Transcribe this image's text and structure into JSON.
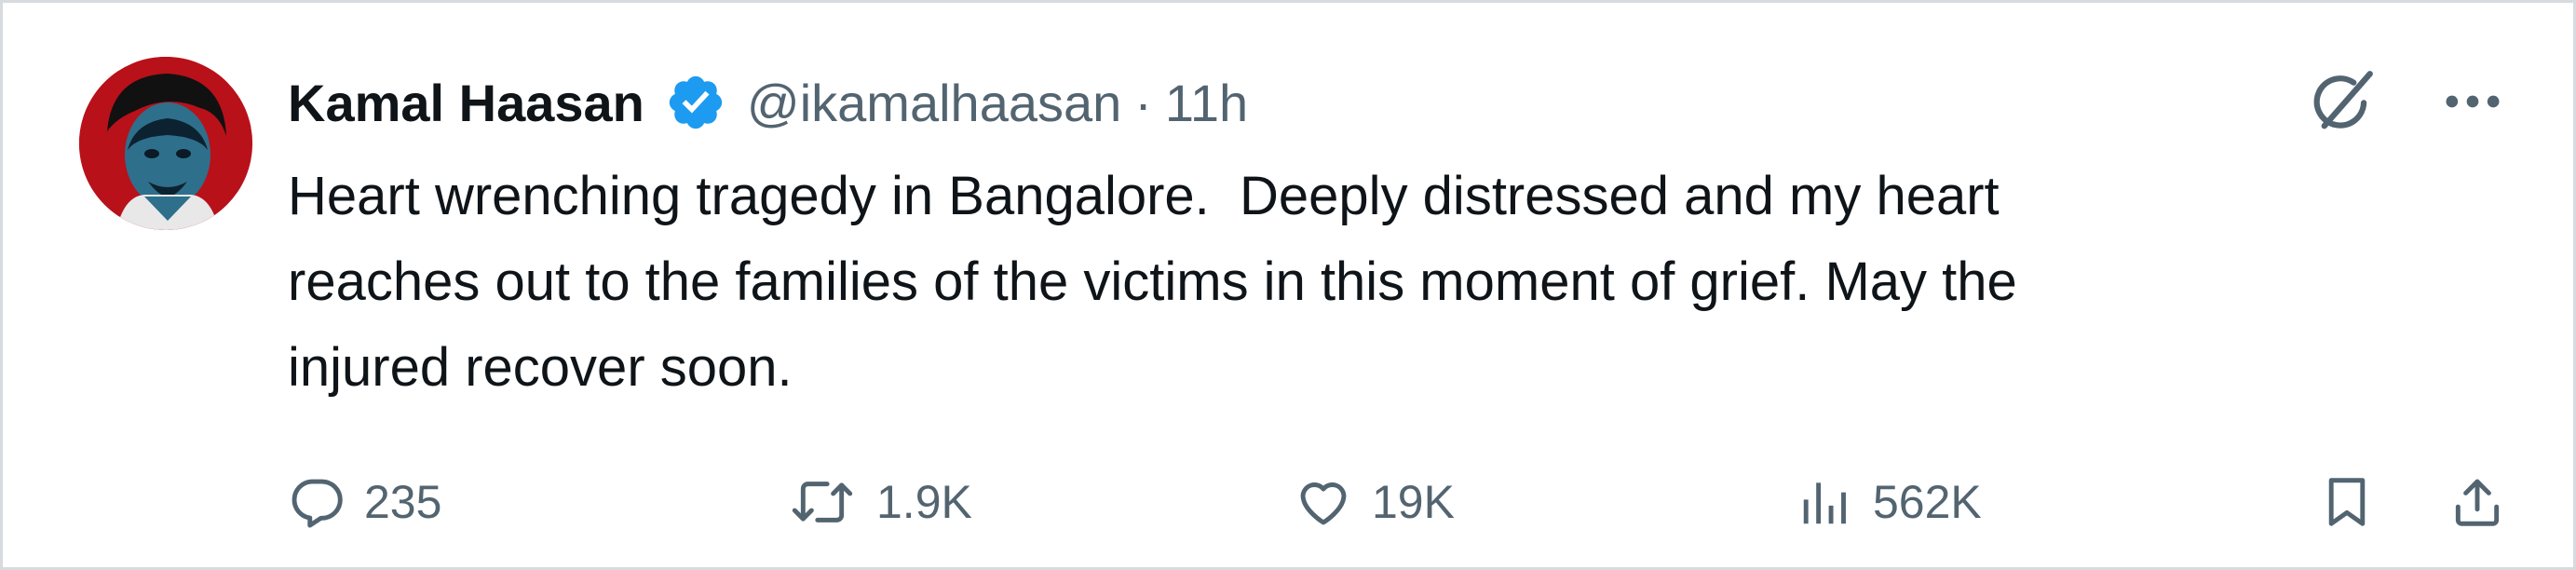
{
  "tweet": {
    "author": {
      "display_name": "Kamal Haasan",
      "verified": true,
      "verified_color": "#1d9bf0",
      "handle": "@ikamalhaasan",
      "separator": "·",
      "time": "11h"
    },
    "text_lines": [
      "Heart wrenching tragedy in Bangalore.  Deeply distressed and my heart",
      "reaches out to the families of the victims in this moment of grief. May the",
      "injured recover soon."
    ],
    "top_icons": [
      "grok-icon",
      "more-icon"
    ],
    "actions": {
      "replies": "235",
      "reposts": "1.9K",
      "likes": "19K",
      "views": "562K"
    },
    "action_icons": [
      "reply-icon",
      "repost-icon",
      "like-icon",
      "views-icon",
      "bookmark-icon",
      "share-icon"
    ],
    "colors": {
      "text": "#0f1419",
      "secondary": "#536471",
      "border": "#d7dbdf",
      "avatar_bg": "#b8111a"
    }
  }
}
